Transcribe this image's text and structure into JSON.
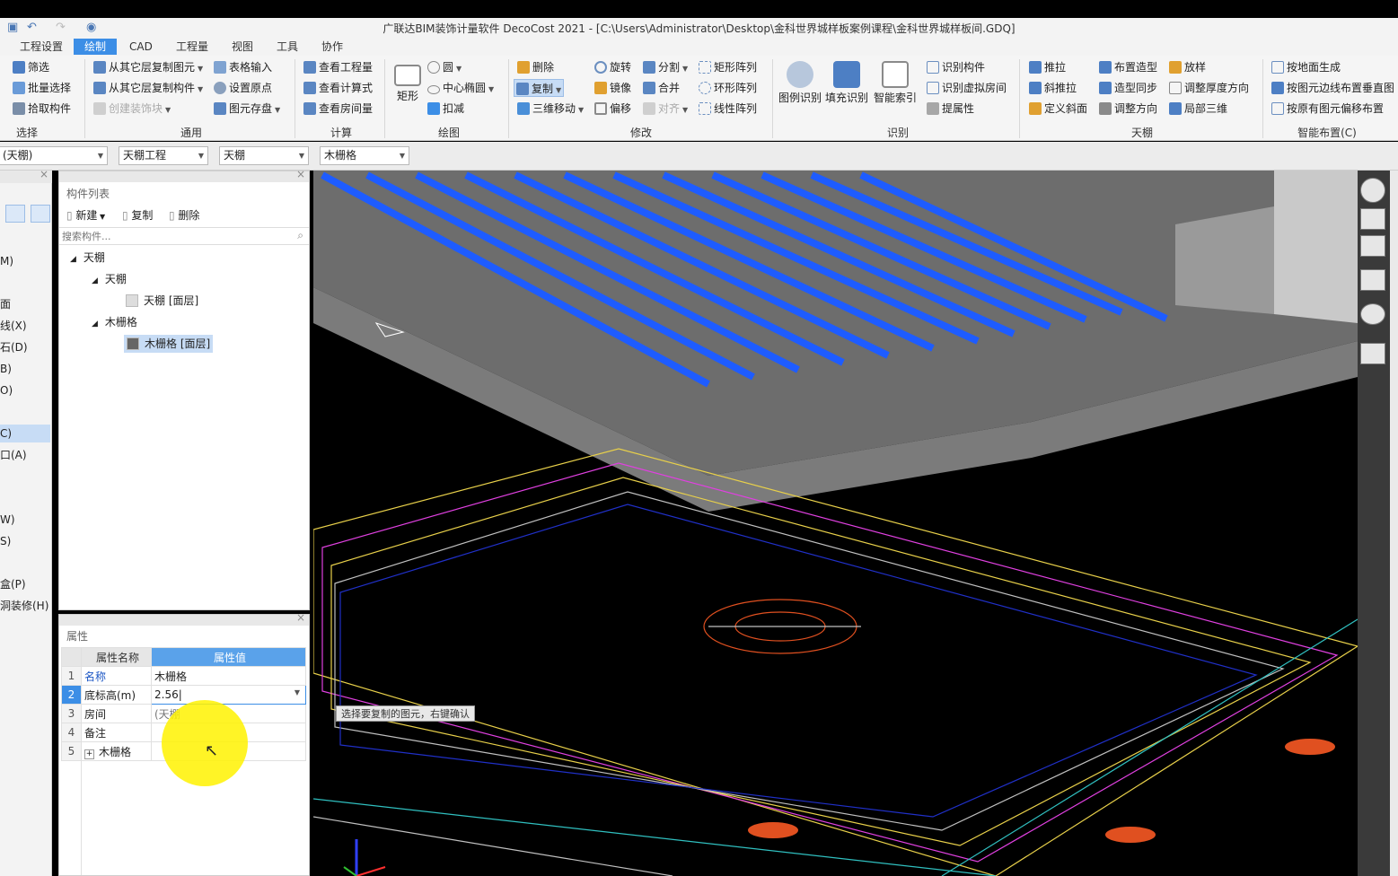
{
  "app": {
    "title": "广联达BIM装饰计量软件 DecoCost 2021 - [C:\\Users\\Administrator\\Desktop\\金科世界城样板案例课程\\金科世界城样板间.GDQ]"
  },
  "menu": [
    "工程设置",
    "绘制",
    "CAD",
    "工程量",
    "视图",
    "工具",
    "协作"
  ],
  "menu_active": "绘制",
  "ribbon": {
    "select": {
      "items": [
        "筛选",
        "批量选择",
        "拾取构件"
      ],
      "group": "选择"
    },
    "general": {
      "items": [
        "从其它层复制图元",
        "从其它层复制构件",
        "创建装饰块",
        "表格输入",
        "设置原点",
        "图元存盘"
      ],
      "group": "通用"
    },
    "calc": {
      "items": [
        "查看工程量",
        "查看计算式",
        "查看房间量"
      ],
      "group": "计算"
    },
    "draw": {
      "big": "矩形",
      "items": [
        "圆",
        "中心椭圆",
        "扣减"
      ],
      "group": "绘图"
    },
    "modify": {
      "items": [
        "删除",
        "复制",
        "三维移动",
        "旋转",
        "镜像",
        "偏移",
        "分割",
        "合并",
        "对齐",
        "矩形阵列",
        "环形阵列",
        "线性阵列"
      ],
      "group": "修改"
    },
    "identify": {
      "big": [
        "图例识别",
        "填充识别",
        "智能索引"
      ],
      "items": [
        "识别构件",
        "识别虚拟房间",
        "提属性"
      ],
      "group": "识别"
    },
    "ceiling": {
      "items": [
        "推拉",
        "斜推拉",
        "定义斜面",
        "布置造型",
        "造型同步",
        "调整方向",
        "放样",
        "调整厚度方向",
        "局部三维"
      ],
      "group": "天棚"
    },
    "smart": {
      "items": [
        "按地面生成",
        "按图元边线布置垂直图",
        "按原有图元偏移布置"
      ],
      "group": "智能布置(C)"
    }
  },
  "selectors": [
    "(天棚)",
    "天棚工程",
    "天棚",
    "木栅格"
  ],
  "left_nav": [
    "M)",
    "面",
    "线(X)",
    "石(D)",
    "B)",
    "O)",
    "C)",
    "口(A)",
    "W)",
    "S)",
    "盒(P)",
    "洞装修(H)"
  ],
  "component_list": {
    "title": "构件列表",
    "toolbar": [
      "新建",
      "复制",
      "删除"
    ],
    "search_placeholder": "搜索构件...",
    "tree": [
      {
        "label": "天棚",
        "level": 0
      },
      {
        "label": "天棚",
        "level": 1
      },
      {
        "label": "天棚 [面层]",
        "level": 2
      },
      {
        "label": "木栅格",
        "level": 1
      },
      {
        "label": "木栅格 [面层]",
        "level": 2,
        "selected": true
      }
    ]
  },
  "properties": {
    "title": "属性",
    "headers": [
      "属性名称",
      "属性值"
    ],
    "rows": [
      {
        "num": "1",
        "name": "名称",
        "value": "木栅格"
      },
      {
        "num": "2",
        "name": "底标高(m)",
        "value": "2.56"
      },
      {
        "num": "3",
        "name": "房间",
        "value": "(天棚"
      },
      {
        "num": "4",
        "name": "备注",
        "value": ""
      },
      {
        "num": "5",
        "name": "木栅格",
        "value": ""
      }
    ]
  },
  "tooltip": "选择要复制的图元，右键确认",
  "colors": {
    "accent": "#3c8ee6",
    "grille": "#1e5cff",
    "cursor_highlight": "#fff200"
  }
}
